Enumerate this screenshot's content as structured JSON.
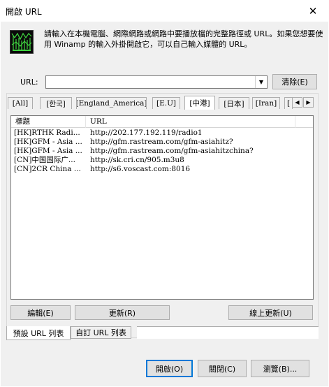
{
  "window": {
    "title": "開啟 URL",
    "close_glyph": "✕"
  },
  "description": "請輸入在本機電腦、網際網路或網路中要播放檔的完整路徑或 URL。如果您想要使用 Winamp 的輸入外掛開啟它，可以自己輸入媒體的 URL。",
  "url_field": {
    "label": "URL:",
    "value": "",
    "arrow_glyph": "▼"
  },
  "buttons": {
    "clear": "清除(E)",
    "edit": "編輯(E)",
    "refresh": "更新(R)",
    "online_update": "線上更新(U)",
    "open": "開啟(O)",
    "close": "關閉(C)",
    "browse": "瀏覽(B)..."
  },
  "tabs": [
    {
      "label": "[All]",
      "selected": false
    },
    {
      "label": "[한국]",
      "selected": false
    },
    {
      "label": "[England_America]",
      "selected": false
    },
    {
      "label": "[E.U]",
      "selected": false
    },
    {
      "label": "[中港]",
      "selected": true
    },
    {
      "label": "[日本]",
      "selected": false
    },
    {
      "label": "[Iran]",
      "selected": false
    },
    {
      "label": "[",
      "selected": false
    }
  ],
  "tab_scroll": {
    "left_glyph": "◀",
    "right_glyph": "▶"
  },
  "list": {
    "columns": [
      "標題",
      "URL"
    ],
    "rows": [
      {
        "title": "[HK]RTHK Radi...",
        "url": "http://202.177.192.119/radio1"
      },
      {
        "title": "[HK]GFM - Asia ...",
        "url": "http://gfm.rastream.com/gfm-asiahitz?"
      },
      {
        "title": "[HK]GFM - Asia ...",
        "url": "http://gfm.rastream.com/gfm-asiahitzchina?"
      },
      {
        "title": "[CN]中国国际广...",
        "url": "http://sk.cri.cn/905.m3u8"
      },
      {
        "title": "[CN]2CR China ...",
        "url": "http://s6.voscast.com:8016"
      }
    ]
  },
  "list_tabs": [
    {
      "label": "預設 URL 列表",
      "selected": true
    },
    {
      "label": "自訂 URL 列表",
      "selected": false
    }
  ],
  "colors": {
    "dialog_bg": "#f0f0f0",
    "button_bg": "#e1e1e1",
    "default_button_border": "#0078d7",
    "logo_green": "#3fd43f"
  },
  "icons": {
    "logo": "winamp-visualizer-logo-icon"
  }
}
